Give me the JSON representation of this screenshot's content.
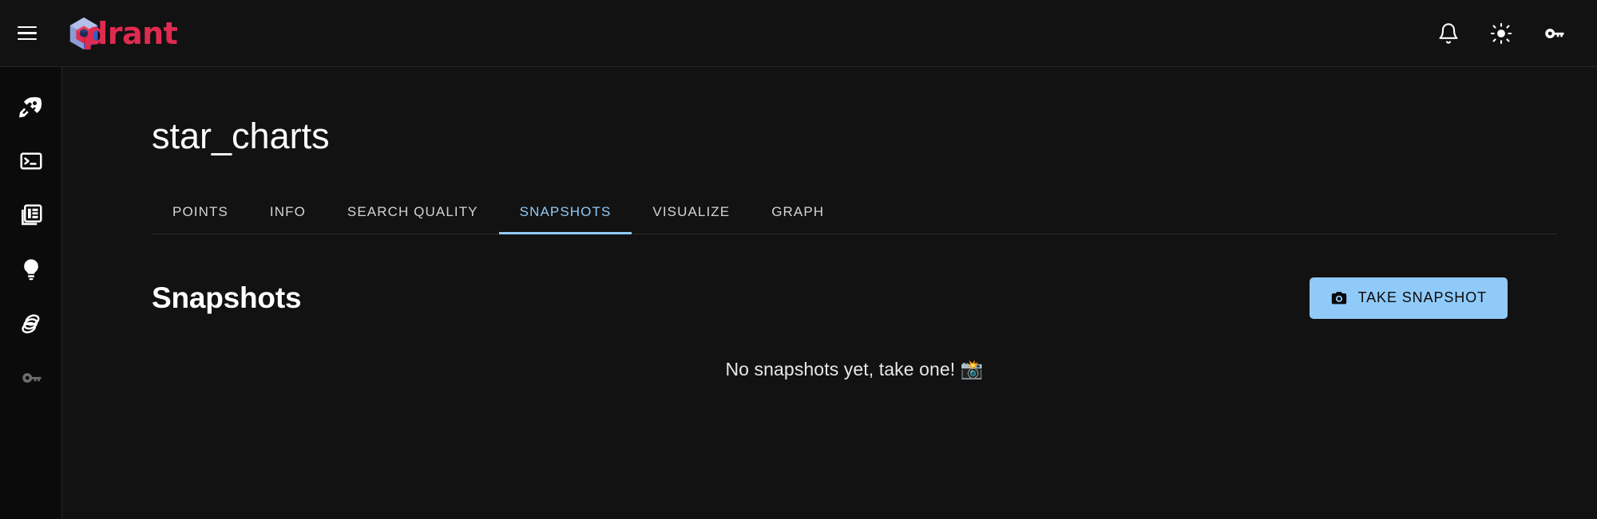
{
  "appbar": {
    "menu_icon": "hamburger-menu-icon",
    "brand_name": "drant",
    "brand_logo_icon": "qdrant-cube-logo-icon",
    "actions": [
      {
        "name": "notifications-button",
        "icon": "bell-icon"
      },
      {
        "name": "theme-toggle-button",
        "icon": "sun-icon"
      },
      {
        "name": "api-key-button",
        "icon": "key-icon"
      }
    ]
  },
  "sidebar": {
    "items": [
      {
        "name": "sidebar-item-welcome",
        "icon": "rocket-icon",
        "dimmed": false
      },
      {
        "name": "sidebar-item-console",
        "icon": "terminal-icon",
        "dimmed": false
      },
      {
        "name": "sidebar-item-collections",
        "icon": "collections-icon",
        "dimmed": false
      },
      {
        "name": "sidebar-item-tutorial",
        "icon": "lightbulb-icon",
        "dimmed": false
      },
      {
        "name": "sidebar-item-datasets",
        "icon": "datasets-icon",
        "dimmed": false
      },
      {
        "name": "sidebar-item-access-tokens",
        "icon": "key-icon",
        "dimmed": true
      }
    ]
  },
  "main": {
    "page_title": "star_charts",
    "tabs": [
      {
        "label": "POINTS",
        "active": false
      },
      {
        "label": "INFO",
        "active": false
      },
      {
        "label": "SEARCH QUALITY",
        "active": false
      },
      {
        "label": "SNAPSHOTS",
        "active": true
      },
      {
        "label": "VISUALIZE",
        "active": false
      },
      {
        "label": "GRAPH",
        "active": false
      }
    ],
    "section": {
      "title": "Snapshots",
      "take_snapshot_label": "TAKE SNAPSHOT",
      "take_snapshot_icon": "camera-icon",
      "empty_message": "No snapshots yet, take one!",
      "empty_emoji": "📸"
    }
  },
  "colors": {
    "accent_blue": "#90caf9",
    "brand_red": "#e02b50",
    "app_background": "#121212",
    "rail_background": "#0b0b0b",
    "border": "#262626"
  }
}
